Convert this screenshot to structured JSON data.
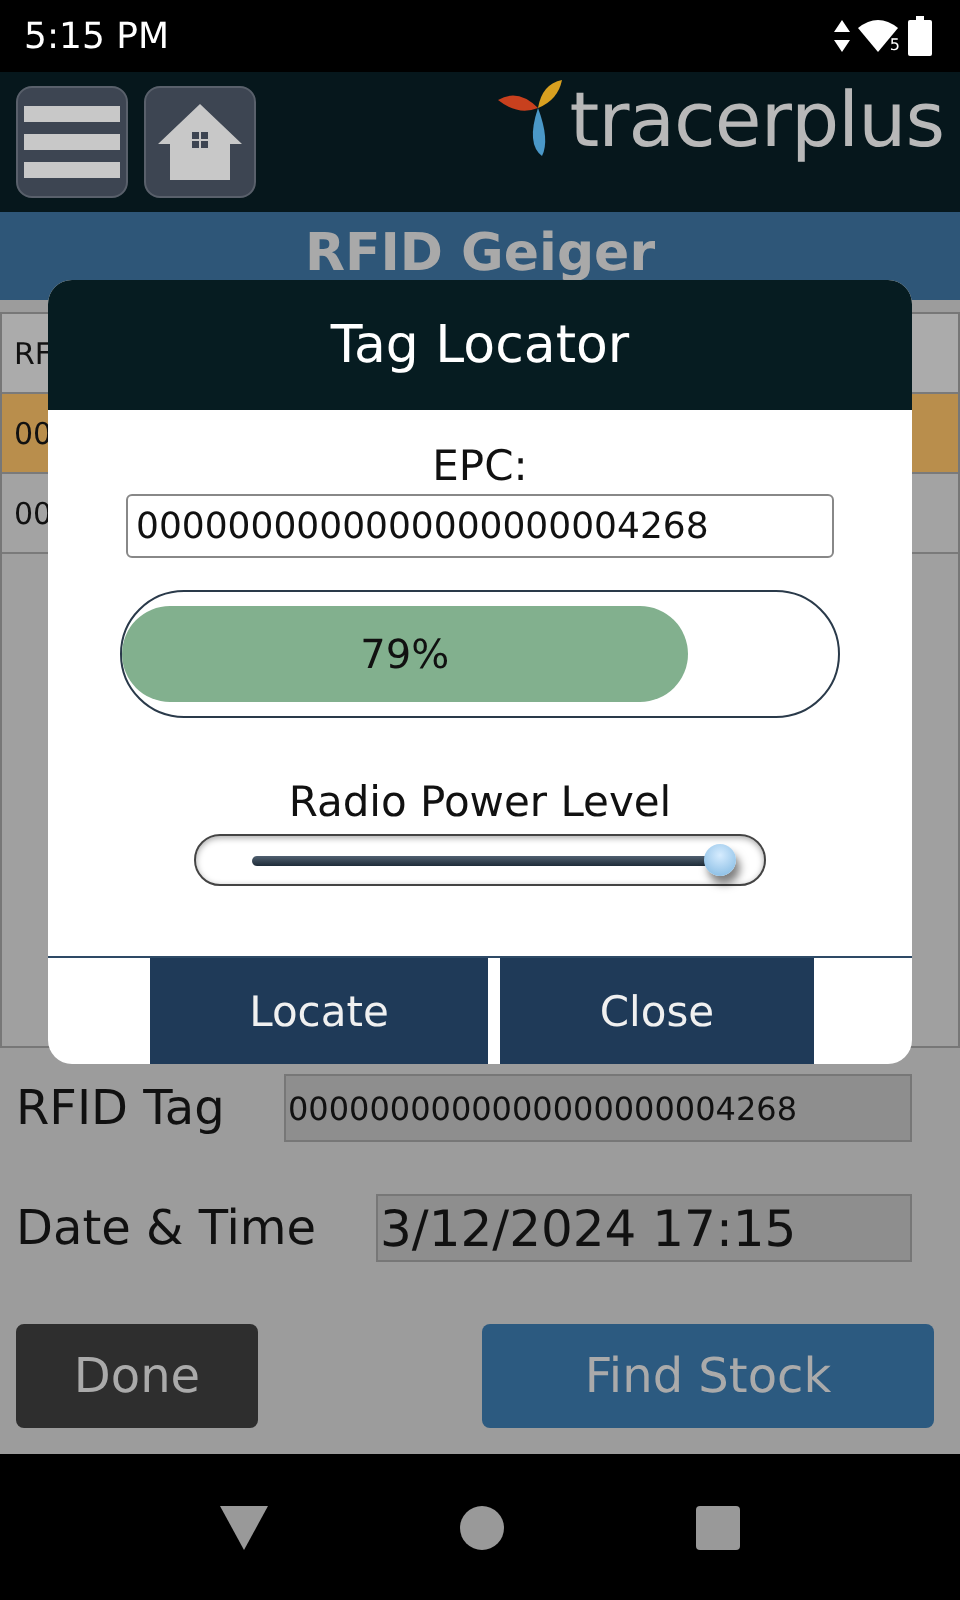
{
  "status_bar": {
    "time": "5:15 PM",
    "wifi_label": "5"
  },
  "header": {
    "logo_text": "tracerplus"
  },
  "title": "RFID Geiger",
  "table": {
    "rows": [
      {
        "cell": "RF",
        "selected": false,
        "kind": "header"
      },
      {
        "cell": "00",
        "selected": true,
        "kind": "row"
      },
      {
        "cell": "00",
        "selected": false,
        "kind": "row"
      }
    ]
  },
  "fields": [
    {
      "label": "RFID Tag",
      "value": "0000000000000000000004268",
      "kind": "small"
    },
    {
      "label": "Date & Time",
      "value": "3/12/2024 17:15",
      "kind": "large"
    }
  ],
  "buttons": [
    {
      "label": "Done",
      "kind": "dark"
    },
    {
      "label": "Find Stock",
      "kind": "primary"
    }
  ],
  "dialog": {
    "title": "Tag Locator",
    "epc_label": "EPC:",
    "epc_value": "0000000000000000000004268",
    "signal": {
      "level": 0.79,
      "reading": "79%"
    },
    "power": {
      "label": "Radio Power Level",
      "level": 1
    },
    "buttons": [
      "Locate",
      "Close"
    ]
  }
}
